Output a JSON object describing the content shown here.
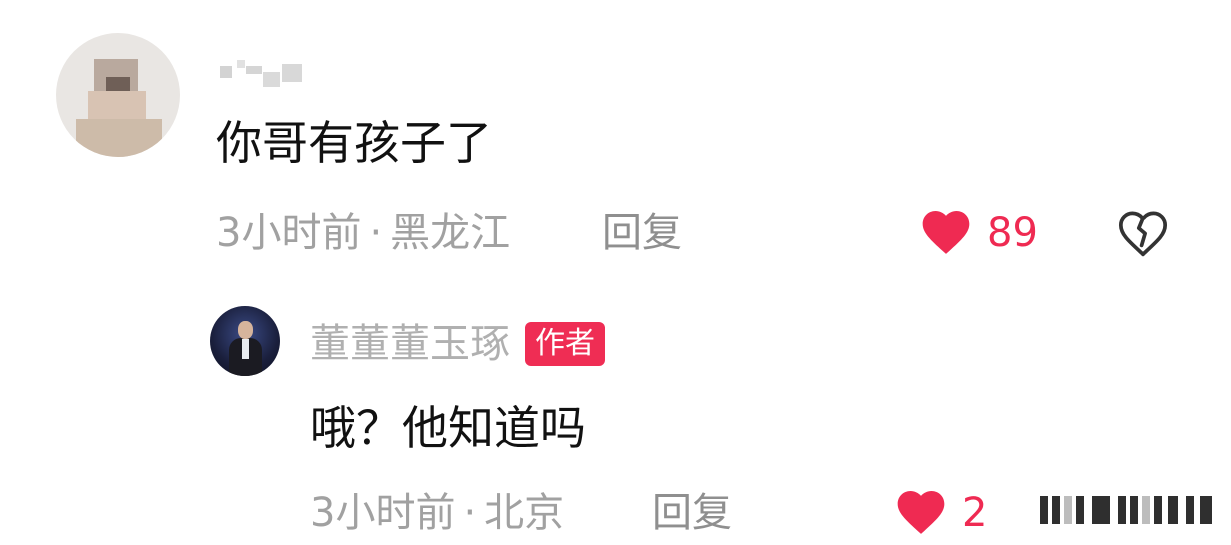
{
  "main_comment": {
    "text": "你哥有孩子了",
    "time": "3小时前",
    "dot": "·",
    "location": "黑龙江",
    "reply_label": "回复",
    "likes": "89"
  },
  "reply_comment": {
    "author": "董董董玉琢",
    "author_badge": "作者",
    "text": "哦？他知道吗",
    "time": "3小时前",
    "dot": "·",
    "location": "北京",
    "reply_label": "回复",
    "likes": "2"
  },
  "icons": {
    "like": "heart-icon",
    "dislike": "broken-heart-icon"
  },
  "colors": {
    "accent": "#EF2A52",
    "meta": "#A1A1A1",
    "text": "#111111"
  }
}
